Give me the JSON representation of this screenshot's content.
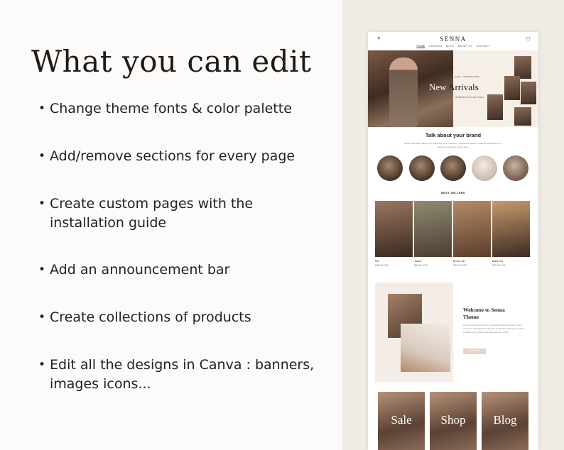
{
  "heading": "What you can edit",
  "features": [
    {
      "lines": [
        "Change theme fonts & color palette"
      ]
    },
    {
      "lines": [
        "Add/remove sections for every page"
      ]
    },
    {
      "lines": [
        "Create custom pages with the",
        "installation guide"
      ]
    },
    {
      "lines": [
        "Add an announcement bar"
      ]
    },
    {
      "lines": [
        "Create collections of products"
      ]
    },
    {
      "lines": [
        "Edit all the designs in Canva : banners,",
        "images  icons..."
      ]
    }
  ],
  "mockup": {
    "logo": "SENNA",
    "nav": [
      "HOME",
      "CATALOG",
      "BLOG",
      "ABOUT US",
      "CONTACT"
    ],
    "hero": {
      "season": "FALL / WINTER 2022",
      "title_white": "New",
      "title_dark": "Arrivals",
      "subtitle": "WOMEN'S COLLECTION"
    },
    "brand_title": "Talk about your brand",
    "brand_text": "Share information about your brand with your customers. Describe a product, make announcements, or welcome customers to your store.",
    "best_sellers": "BEST SELLERS",
    "products": [
      {
        "name": "Hat",
        "price": "$38.00 USD"
      },
      {
        "name": "Jacket",
        "price": "$89.00 USD"
      },
      {
        "name": "Brown Top",
        "price": "$39.00 USD"
      },
      {
        "name": "Black Top",
        "price": "$29.00 USD"
      }
    ],
    "welcome_title_1": "Welcome to Senna",
    "welcome_title_2": "Theme",
    "welcome_text": "Lorem ipsum dolor sit amet, consectetur adipiscing elit. Donec non elit at velit dignissim vehicula. Vestibulum ante ipsum primis in faucibus orci luctus et ultrices posuere cubilia.",
    "welcome_button": "SHOP NOW",
    "cards": [
      "Sale",
      "Shop",
      "Blog"
    ]
  }
}
